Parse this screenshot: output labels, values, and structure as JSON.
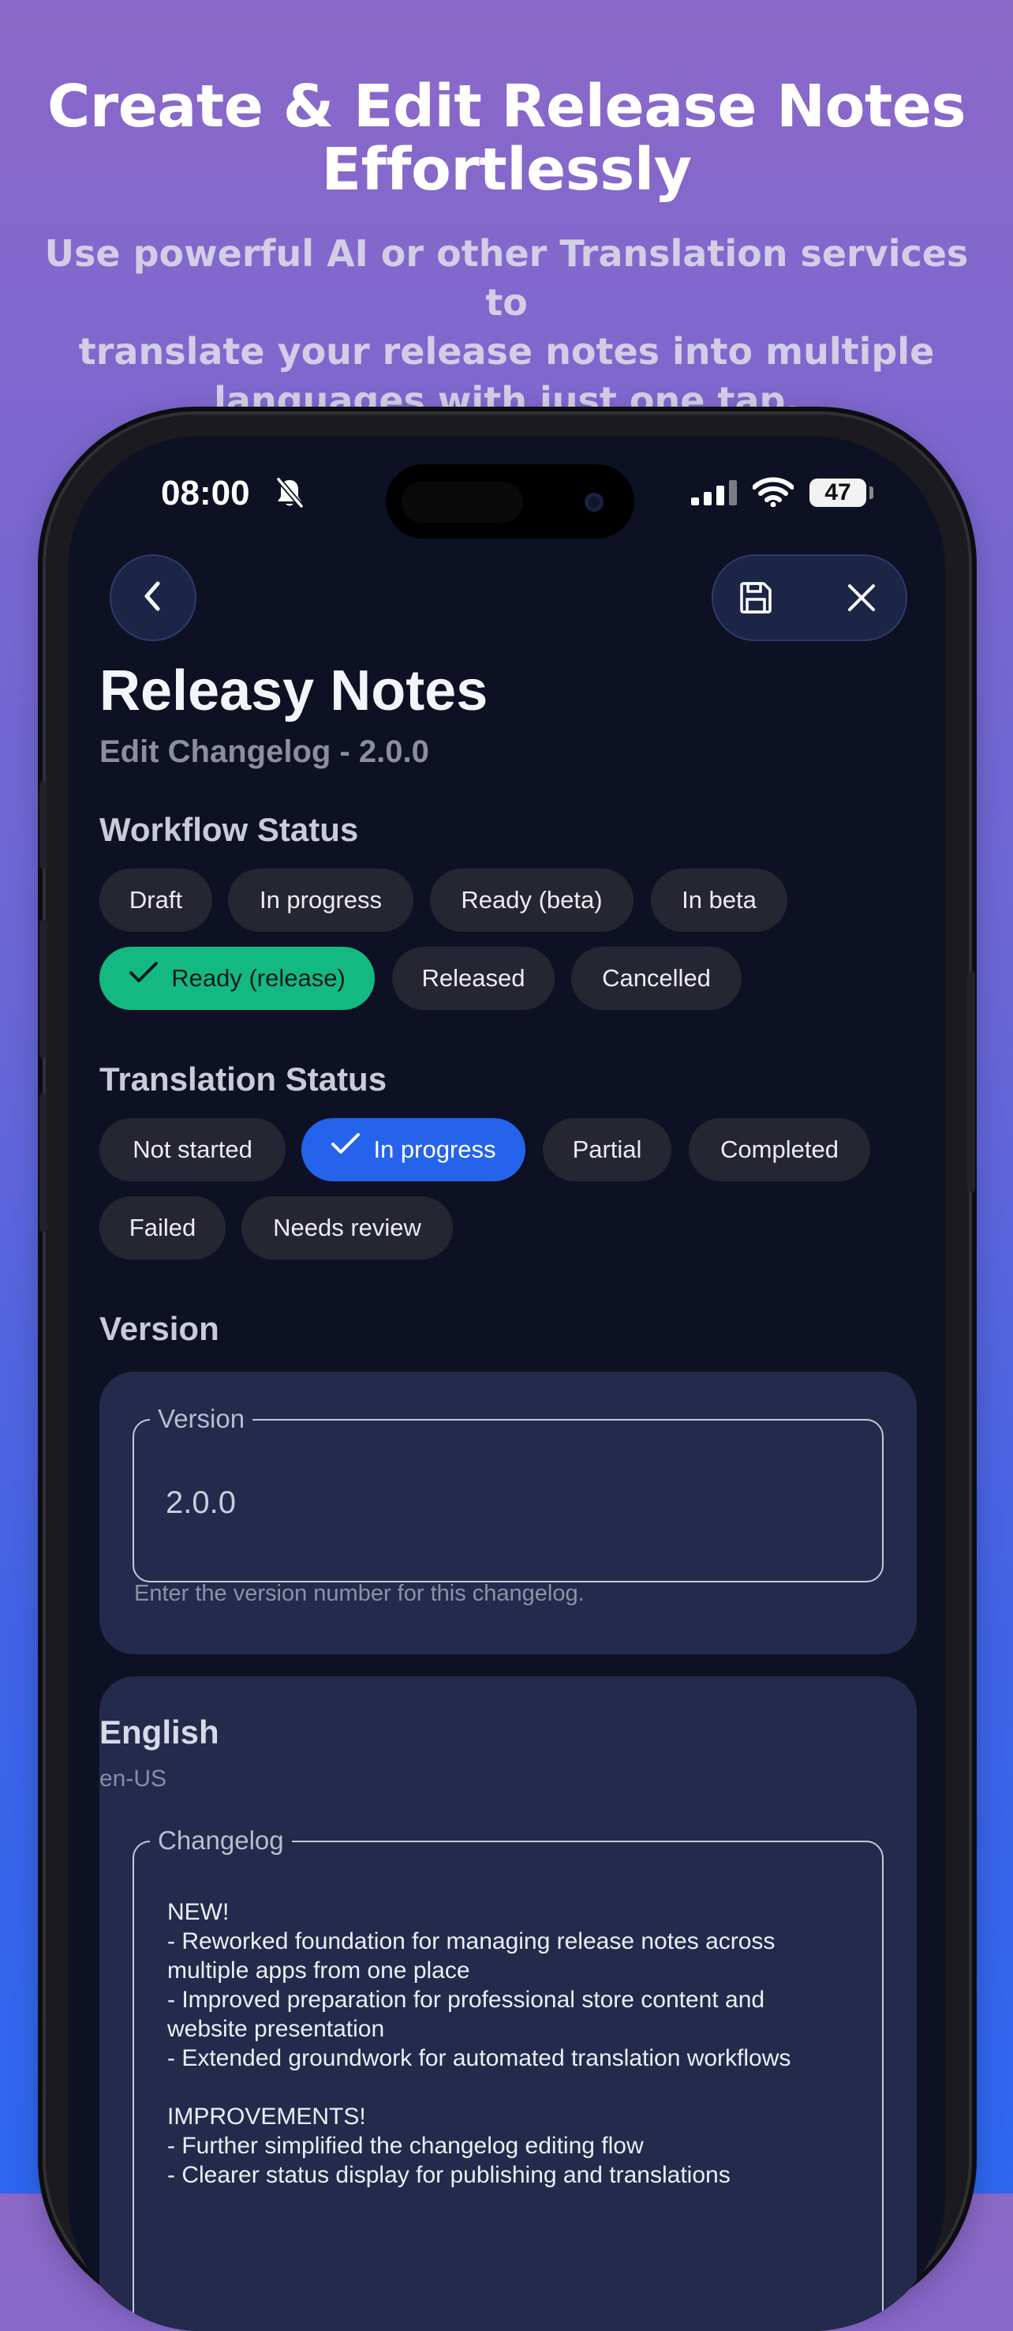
{
  "promo": {
    "title_line1": "Create & Edit Release Notes",
    "title_line2": "Effortlessly",
    "subtitle_line1": "Use powerful AI or other Translation services  to",
    "subtitle_line2": "translate your release notes into multiple",
    "subtitle_line3": "languages with just one tap."
  },
  "status_bar": {
    "time": "08:00",
    "battery": "47",
    "icons": [
      "bell-slash-icon",
      "signal-icon",
      "wifi-icon",
      "battery-icon"
    ]
  },
  "toolbar": {
    "back_icon": "chevron-left-icon",
    "save_icon": "save-icon",
    "close_icon": "close-icon"
  },
  "header": {
    "title": "Releasy Notes",
    "subtitle": "Edit Changelog - 2.0.0"
  },
  "workflow": {
    "heading": "Workflow Status",
    "options": [
      "Draft",
      "In progress",
      "Ready (beta)",
      "In beta",
      "Ready (release)",
      "Released",
      "Cancelled"
    ],
    "selected": "Ready (release)",
    "selected_color": "#13b981"
  },
  "translation": {
    "heading": "Translation Status",
    "options": [
      "Not started",
      "In progress",
      "Partial",
      "Completed",
      "Failed",
      "Needs review"
    ],
    "selected": "In progress",
    "selected_color": "#2563eb"
  },
  "version": {
    "heading": "Version",
    "field_label": "Version",
    "value": "2.0.0",
    "helper": "Enter the version number for this changelog."
  },
  "language_card": {
    "name": "English",
    "code": "en-US",
    "field_label": "Changelog",
    "text": "NEW!\n- Reworked foundation for managing release notes across\nmultiple apps from one place\n- Improved preparation for professional store content and\nwebsite presentation\n- Extended groundwork for automated translation workflows\n\nIMPROVEMENTS!\n- Further simplified the changelog editing flow\n- Clearer status display for publishing and translations"
  }
}
